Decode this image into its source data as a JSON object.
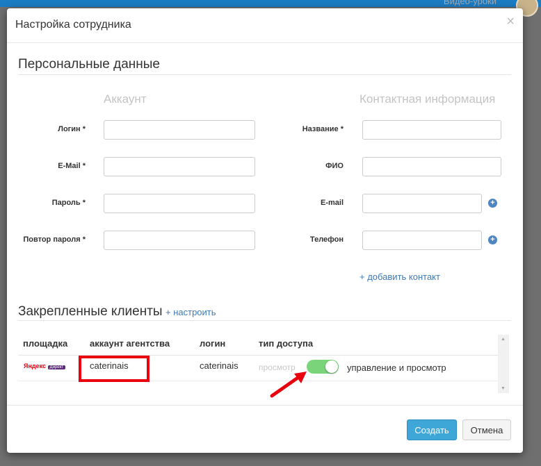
{
  "background": {
    "top_link": "Видео-уроки"
  },
  "dialog": {
    "title": "Настройка сотрудника",
    "close": "×"
  },
  "personal": {
    "title": "Персональные данные",
    "account_heading": "Аккаунт",
    "contact_heading": "Контактная информация",
    "account_fields": [
      {
        "label": "Логин *",
        "value": ""
      },
      {
        "label": "E-Mail *",
        "value": ""
      },
      {
        "label": "Пароль *",
        "value": ""
      },
      {
        "label": "Повтор пароля *",
        "value": ""
      }
    ],
    "contact_fields": [
      {
        "label": "Название *",
        "value": ""
      },
      {
        "label": "ФИО",
        "value": ""
      },
      {
        "label": "E-mail",
        "value": ""
      },
      {
        "label": "Телефон",
        "value": ""
      }
    ],
    "add_contact": "+ добавить контакт"
  },
  "clients": {
    "title": "Закрепленные клиенты",
    "configure": "+ настроить",
    "columns": [
      "площадка",
      "аккаунт агентства",
      "логин",
      "тип доступа"
    ],
    "rows": [
      {
        "platform_logo": "Яндекс",
        "platform_badge": "Директ",
        "agency_account": "caterinais",
        "login": "caterinais",
        "access_off_label": "просмотр",
        "access_on_label": "управление и просмотр",
        "access_enabled": true
      }
    ]
  },
  "buttons": {
    "create": "Создать",
    "cancel": "Отмена"
  },
  "colors": {
    "accent": "#3fa7d8",
    "toggle_on": "#7ad47a",
    "highlight": "#e8000f",
    "link": "#3e7ab7"
  }
}
